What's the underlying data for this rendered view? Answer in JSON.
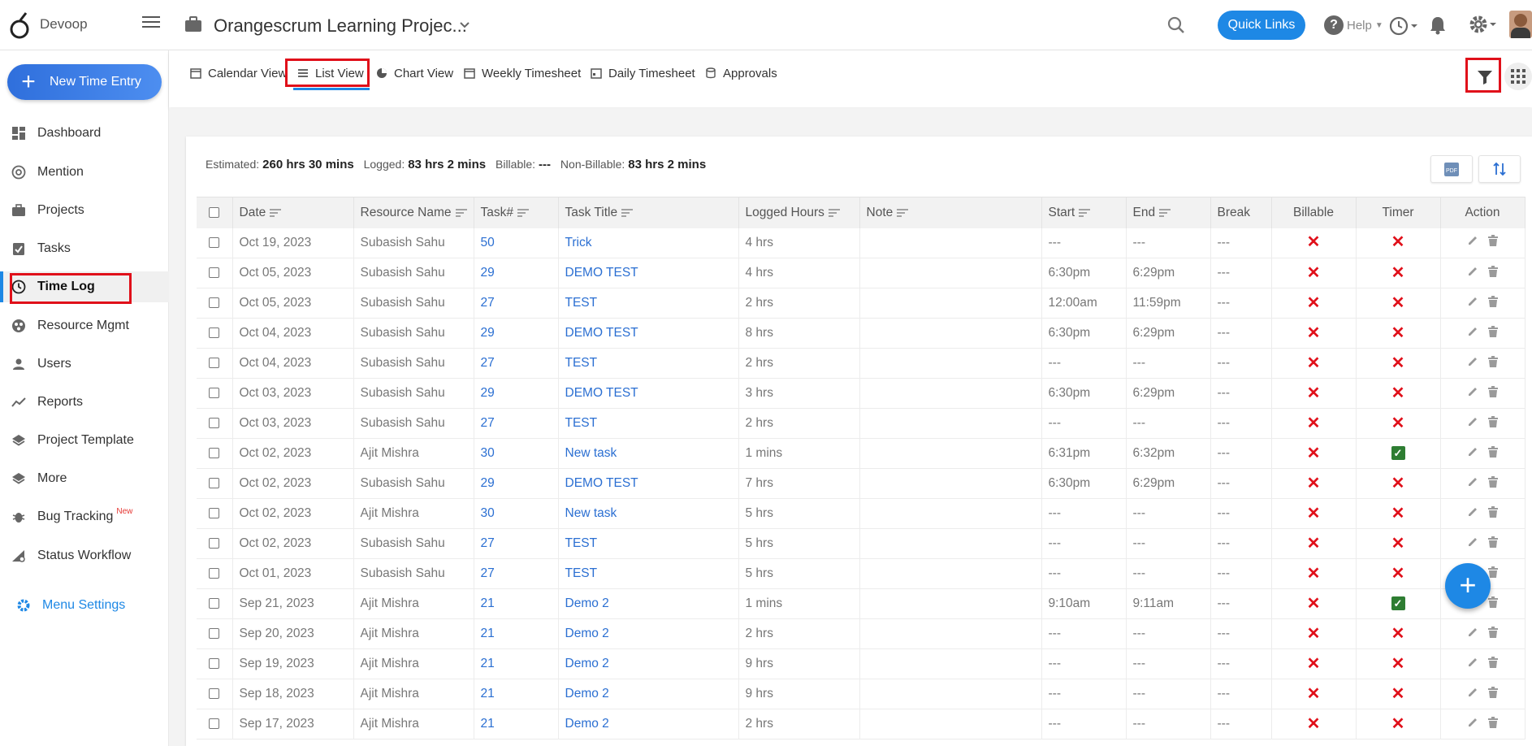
{
  "header": {
    "logo_text": "Devoop",
    "project_title": "Orangescrum Learning Projec...",
    "quick_links": "Quick Links",
    "help": "Help"
  },
  "sidebar": {
    "new_entry": "New Time Entry",
    "items": [
      {
        "label": "Dashboard",
        "icon": "dashboard-icon"
      },
      {
        "label": "Mention",
        "icon": "at-icon"
      },
      {
        "label": "Projects",
        "icon": "briefcase-icon"
      },
      {
        "label": "Tasks",
        "icon": "clipboard-check-icon"
      },
      {
        "label": "Time Log",
        "icon": "clock-icon"
      },
      {
        "label": "Resource Mgmt",
        "icon": "resource-icon"
      },
      {
        "label": "Users",
        "icon": "user-icon"
      },
      {
        "label": "Reports",
        "icon": "trend-icon"
      },
      {
        "label": "Project Template",
        "icon": "layers-icon"
      },
      {
        "label": "More",
        "icon": "layers-icon"
      },
      {
        "label": "Bug Tracking",
        "icon": "bug-icon",
        "badge": "New"
      },
      {
        "label": "Status Workflow",
        "icon": "workflow-icon"
      }
    ],
    "menu_settings": "Menu Settings"
  },
  "tabs": [
    "Calendar View",
    "List View",
    "Chart View",
    "Weekly Timesheet",
    "Daily Timesheet",
    "Approvals"
  ],
  "summary": {
    "estimated_label": "Estimated:",
    "estimated": "260 hrs 30 mins",
    "logged_label": "Logged:",
    "logged": "83 hrs 2 mins",
    "billable_label": "Billable:",
    "billable": "---",
    "nonbillable_label": "Non-Billable:",
    "nonbillable": "83 hrs 2 mins"
  },
  "table": {
    "headers": [
      "Date",
      "Resource Name",
      "Task#",
      "Task Title",
      "Logged Hours",
      "Note",
      "Start",
      "End",
      "Break",
      "Billable",
      "Timer",
      "Action"
    ],
    "rows": [
      [
        "Oct 19, 2023",
        "Subasish Sahu",
        "50",
        "Trick",
        "4 hrs",
        "",
        "---",
        "---",
        "---",
        "x",
        "x"
      ],
      [
        "Oct 05, 2023",
        "Subasish Sahu",
        "29",
        "DEMO TEST",
        "4 hrs",
        "",
        "6:30pm",
        "6:29pm",
        "---",
        "x",
        "x"
      ],
      [
        "Oct 05, 2023",
        "Subasish Sahu",
        "27",
        "TEST",
        "2 hrs",
        "",
        "12:00am",
        "11:59pm",
        "---",
        "x",
        "x"
      ],
      [
        "Oct 04, 2023",
        "Subasish Sahu",
        "29",
        "DEMO TEST",
        "8 hrs",
        "",
        "6:30pm",
        "6:29pm",
        "---",
        "x",
        "x"
      ],
      [
        "Oct 04, 2023",
        "Subasish Sahu",
        "27",
        "TEST",
        "2 hrs",
        "",
        "---",
        "---",
        "---",
        "x",
        "x"
      ],
      [
        "Oct 03, 2023",
        "Subasish Sahu",
        "29",
        "DEMO TEST",
        "3 hrs",
        "",
        "6:30pm",
        "6:29pm",
        "---",
        "x",
        "x"
      ],
      [
        "Oct 03, 2023",
        "Subasish Sahu",
        "27",
        "TEST",
        "2 hrs",
        "",
        "---",
        "---",
        "---",
        "x",
        "x"
      ],
      [
        "Oct 02, 2023",
        "Ajit Mishra",
        "30",
        "New task",
        "1 mins",
        "",
        "6:31pm",
        "6:32pm",
        "---",
        "x",
        "check"
      ],
      [
        "Oct 02, 2023",
        "Subasish Sahu",
        "29",
        "DEMO TEST",
        "7 hrs",
        "",
        "6:30pm",
        "6:29pm",
        "---",
        "x",
        "x"
      ],
      [
        "Oct 02, 2023",
        "Ajit Mishra",
        "30",
        "New task",
        "5 hrs",
        "",
        "---",
        "---",
        "---",
        "x",
        "x"
      ],
      [
        "Oct 02, 2023",
        "Subasish Sahu",
        "27",
        "TEST",
        "5 hrs",
        "",
        "---",
        "---",
        "---",
        "x",
        "x"
      ],
      [
        "Oct 01, 2023",
        "Subasish Sahu",
        "27",
        "TEST",
        "5 hrs",
        "",
        "---",
        "---",
        "---",
        "x",
        "x"
      ],
      [
        "Sep 21, 2023",
        "Ajit Mishra",
        "21",
        "Demo 2",
        "1 mins",
        "",
        "9:10am",
        "9:11am",
        "---",
        "x",
        "check"
      ],
      [
        "Sep 20, 2023",
        "Ajit Mishra",
        "21",
        "Demo 2",
        "2 hrs",
        "",
        "---",
        "---",
        "---",
        "x",
        "x"
      ],
      [
        "Sep 19, 2023",
        "Ajit Mishra",
        "21",
        "Demo 2",
        "9 hrs",
        "",
        "---",
        "---",
        "---",
        "x",
        "x"
      ],
      [
        "Sep 18, 2023",
        "Ajit Mishra",
        "21",
        "Demo 2",
        "9 hrs",
        "",
        "---",
        "---",
        "---",
        "x",
        "x"
      ],
      [
        "Sep 17, 2023",
        "Ajit Mishra",
        "21",
        "Demo 2",
        "2 hrs",
        "",
        "---",
        "---",
        "---",
        "x",
        "x"
      ]
    ]
  },
  "colors": {
    "accent": "#1e88e5",
    "highlight_box": "#e0101a"
  }
}
